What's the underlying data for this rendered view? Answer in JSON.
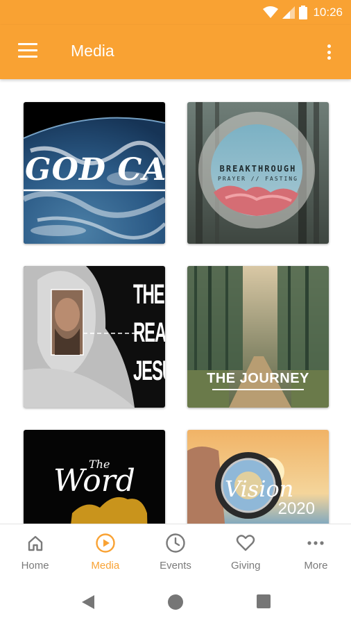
{
  "status_bar": {
    "time": "10:26"
  },
  "app_bar": {
    "title": "Media"
  },
  "media_tiles": [
    {
      "title": "GOD CAN"
    },
    {
      "title": "BREAKTHROUGH",
      "subtitle": "PRAYER // FASTING"
    },
    {
      "title_lines": [
        "THE",
        "REAL",
        "JESUS"
      ]
    },
    {
      "title": "THE JOURNEY"
    },
    {
      "title_small": "The",
      "title": "Word"
    },
    {
      "title": "Vision",
      "year": "2020"
    }
  ],
  "bottom_nav": {
    "items": [
      {
        "label": "Home",
        "icon": "home-icon"
      },
      {
        "label": "Media",
        "icon": "play-circle-icon",
        "active": true
      },
      {
        "label": "Events",
        "icon": "clock-icon"
      },
      {
        "label": "Giving",
        "icon": "heart-icon"
      },
      {
        "label": "More",
        "icon": "more-horizontal-icon"
      }
    ]
  },
  "colors": {
    "accent": "#f9a233",
    "nav_inactive": "#7a7a7a",
    "system_icon": "#767676"
  }
}
